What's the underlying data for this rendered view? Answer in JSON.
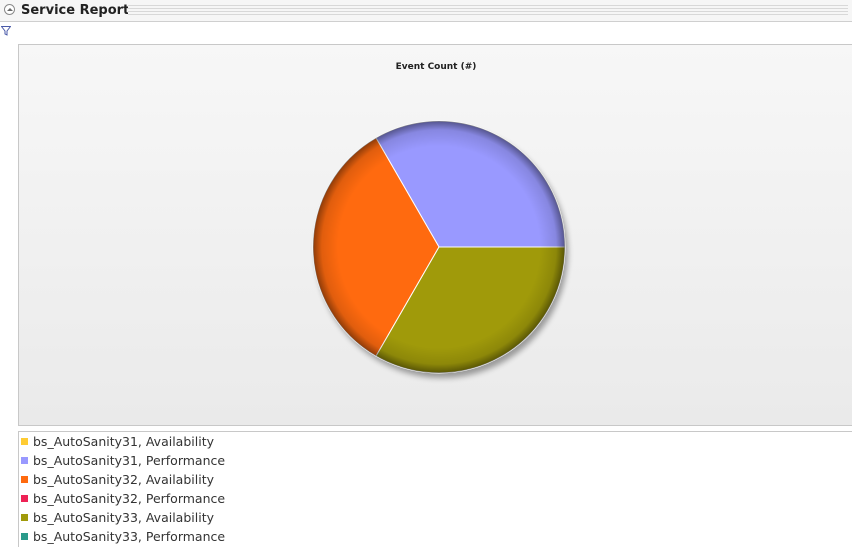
{
  "panel": {
    "title": "Service Report"
  },
  "icons": {
    "collapse": "collapse-icon",
    "filter": "filter-icon"
  },
  "chart_data": {
    "type": "pie",
    "title": "Event Count (#)",
    "categories": [
      "bs_AutoSanity31, Availability",
      "bs_AutoSanity31, Performance",
      "bs_AutoSanity32, Availability",
      "bs_AutoSanity32, Performance",
      "bs_AutoSanity33, Availability",
      "bs_AutoSanity33, Performance"
    ],
    "values": [
      0,
      1,
      1,
      0,
      1,
      0
    ],
    "colors": [
      "#ffcc33",
      "#9999ff",
      "#ff6a0f",
      "#ee2255",
      "#a09a0a",
      "#2a9a8a"
    ],
    "legend": "bottom"
  }
}
